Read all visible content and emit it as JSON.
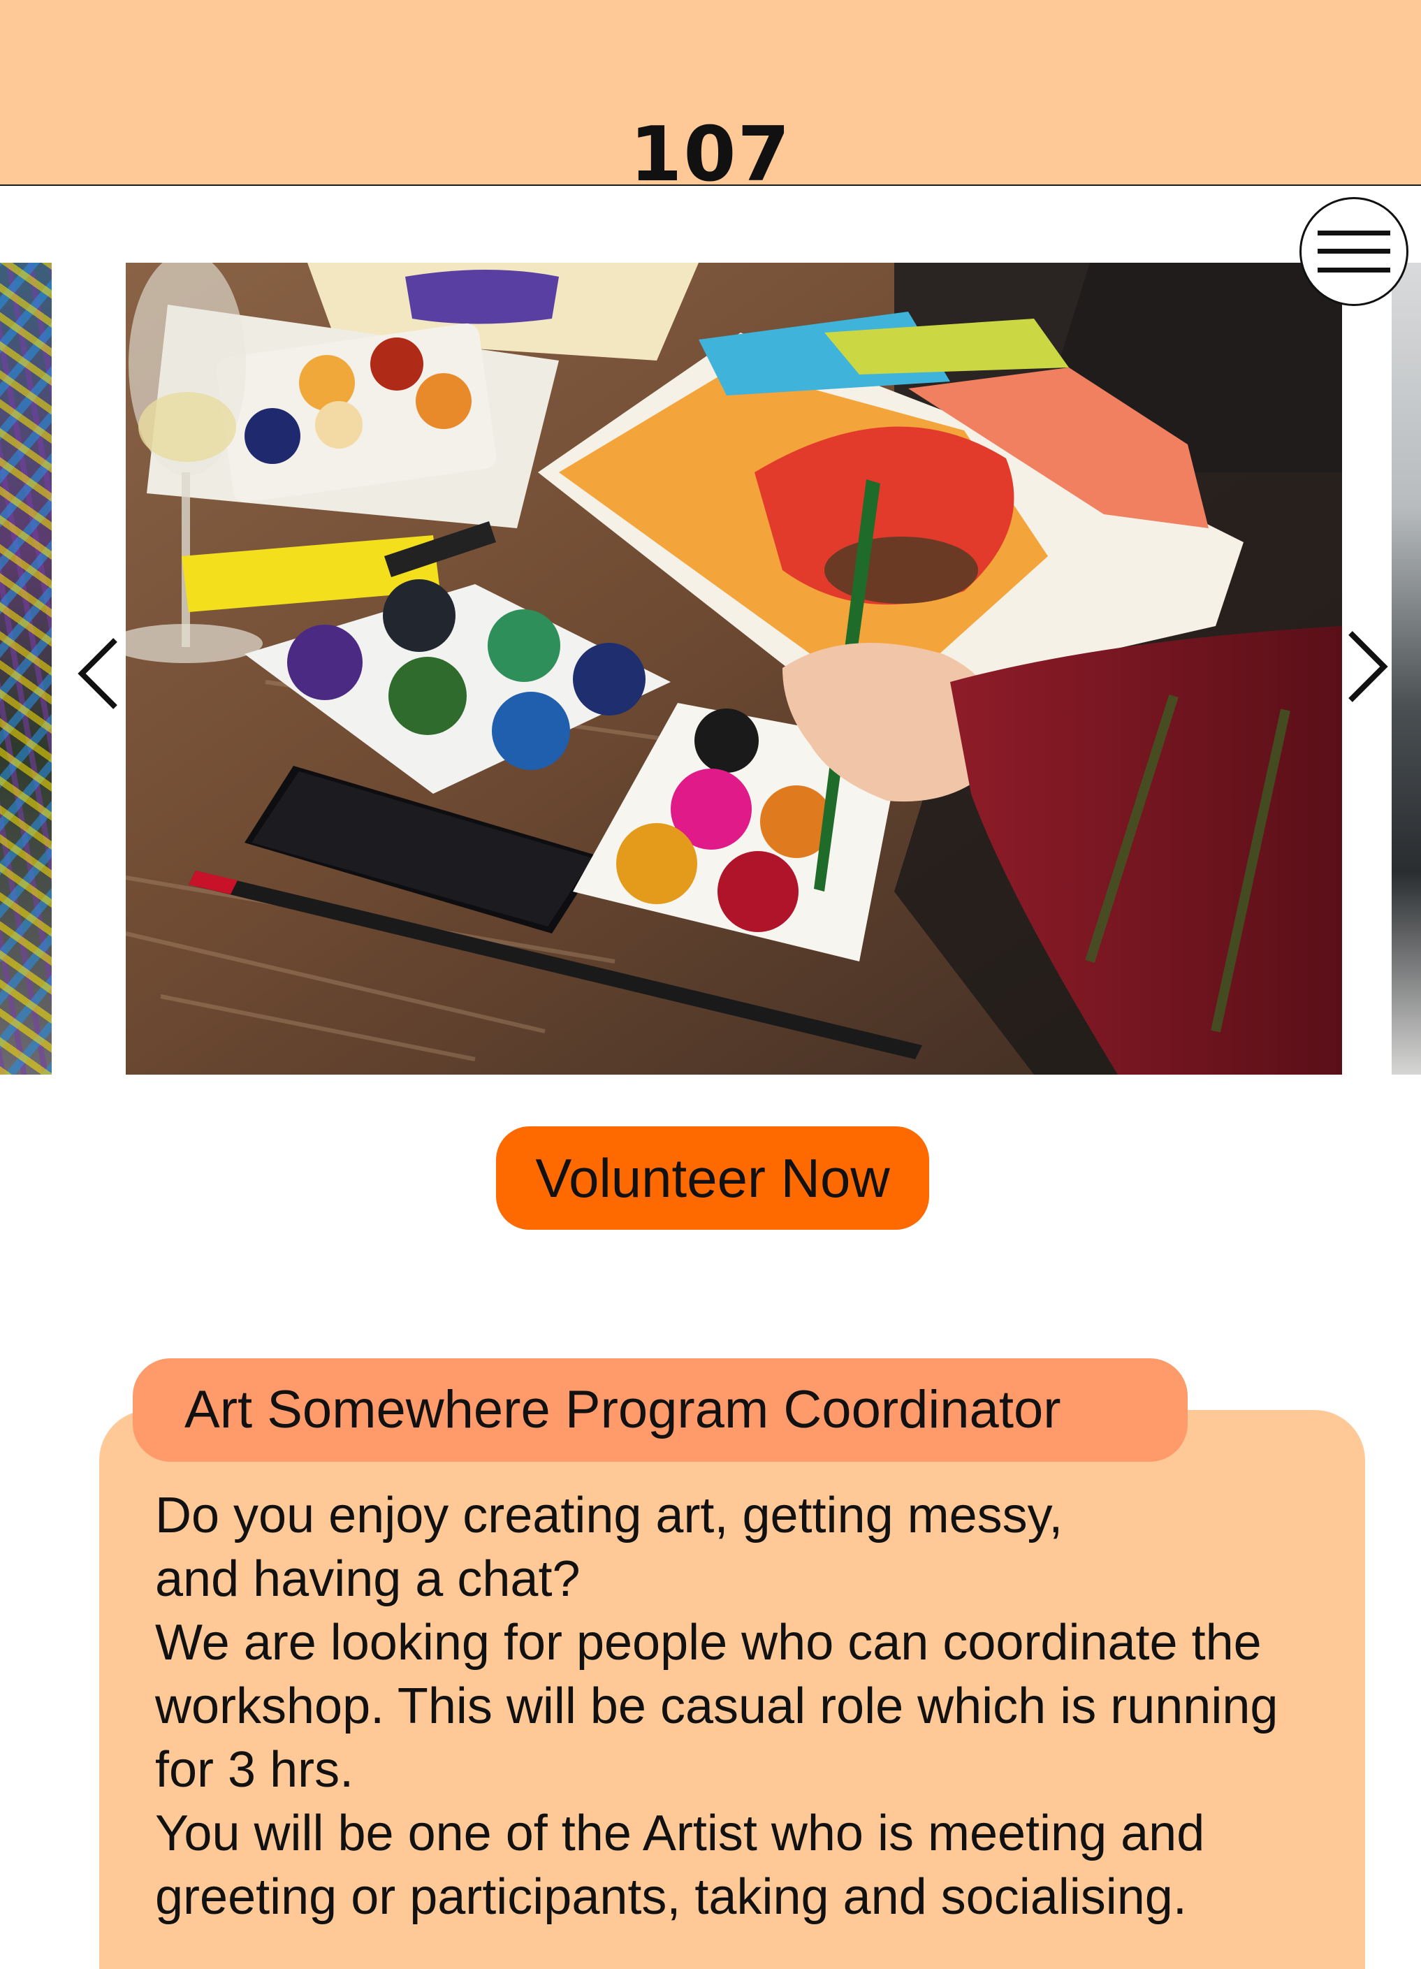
{
  "header": {
    "logo_text": "107",
    "background": "#FFC897"
  },
  "menu": {
    "icon": "hamburger-menu-icon",
    "aria_label": "Menu"
  },
  "carousel": {
    "prev_icon": "chevron-left-icon",
    "next_icon": "chevron-right-icon",
    "image_alt": "Hands painting with watercolour palettes and brushes on a wooden table"
  },
  "cta": {
    "label": "Volunteer Now",
    "color": "#FF6A00"
  },
  "role": {
    "title": "Art Somewhere Program Coordinator",
    "tab_color": "#FF9A6A",
    "card_color": "#FFC897",
    "lines": [
      "Do you enjoy creating art, getting messy,",
      "and having a chat?",
      "We are looking for people who can coordinate the",
      "workshop. This will be casual role which is running",
      "for 3 hrs.",
      "You will be one of the Artist who is meeting and",
      "greeting or participants, taking and socialising."
    ]
  }
}
